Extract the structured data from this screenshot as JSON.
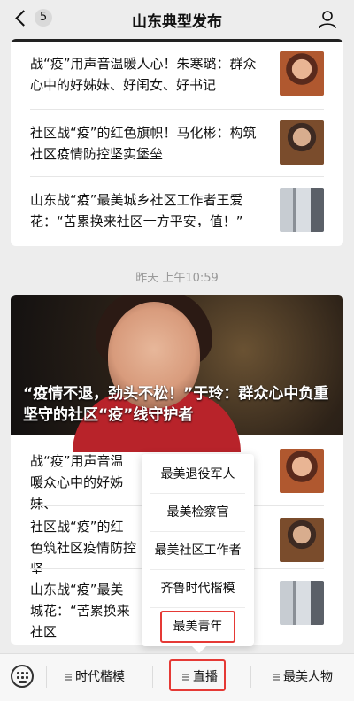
{
  "nav": {
    "back_badge": "5",
    "title": "山东典型发布"
  },
  "articles_top": [
    {
      "title": "战“疫”用声音温暖人心！朱寒璐：群众心中的好姊妹、好闺女、好书记",
      "thumb_color": "#b0582f"
    },
    {
      "title": "社区战“疫”的红色旗帜！马化彬：构筑社区疫情防控坚实堡垒",
      "thumb_color": "#7a4c2c"
    },
    {
      "title": "山东战“疫”最美城乡社区工作者王爱花：“苦累换来社区一方平安，值！”",
      "thumb_color": "#8a8f96"
    }
  ],
  "timestamp": "昨天 上午10:59",
  "hero": {
    "caption": "“疫情不退，劲头不松！”于玲：群众心中负重坚守的社区“疫”线守护者"
  },
  "articles_bottom": [
    {
      "title": "战“疫”用声音温暖众心中的好姊妹、"
    },
    {
      "title": "社区战“疫”的红色筑社区疫情防控坚"
    },
    {
      "title": "山东战“疫”最美城花：“苦累换来社区"
    }
  ],
  "popup_menu": [
    "最美退役军人",
    "最美检察官",
    "最美社区工作者",
    "齐鲁时代楷模",
    "最美青年"
  ],
  "bottom_bar": {
    "tab1": "时代楷模",
    "tab2": "直播",
    "tab3": "最美人物"
  },
  "highlight_color": "#e53935"
}
